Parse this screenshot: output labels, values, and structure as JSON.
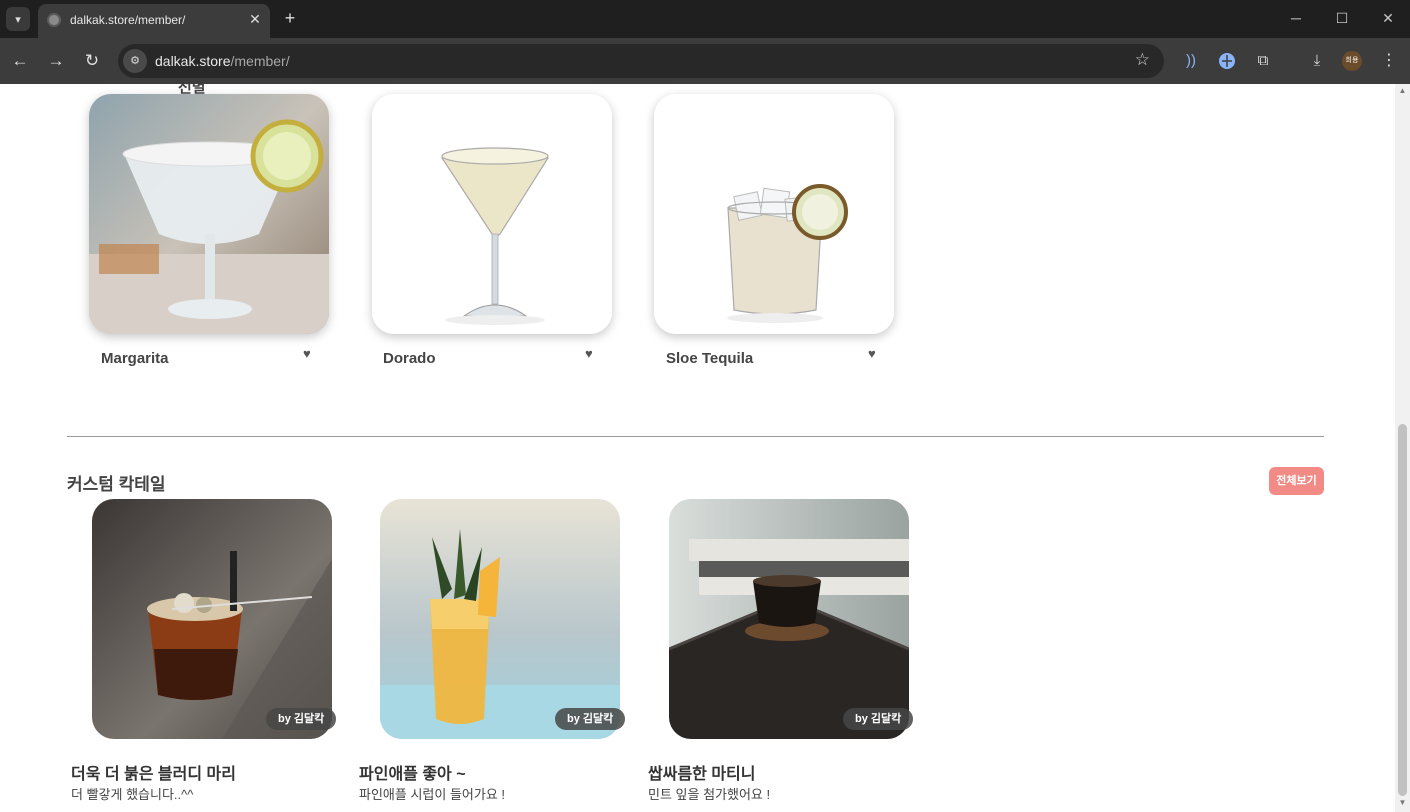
{
  "browser": {
    "tab_title": "dalkak.store/member/",
    "url_host": "dalkak.store",
    "url_path": "/member/",
    "profile_label": "희용",
    "icons": [
      "tab-search-icon",
      "globe-icon",
      "close-icon",
      "plus-icon",
      "minimize-icon",
      "maximize-icon",
      "window-close-icon",
      "back-icon",
      "forward-icon",
      "reload-icon",
      "site-settings-icon",
      "star-icon",
      "cast-icon",
      "extension-globe-icon",
      "extensions-puzzle-icon",
      "download-icon",
      "kebab-menu-icon"
    ]
  },
  "favorites": {
    "section_heading_partial": "선별",
    "items": [
      {
        "name": "Margarita",
        "icon": "heart-icon"
      },
      {
        "name": "Dorado",
        "icon": "heart-icon"
      },
      {
        "name": "Sloe Tequila",
        "icon": "heart-icon"
      }
    ]
  },
  "custom": {
    "title": "커스텀 칵테일",
    "view_all": "전체보기",
    "items": [
      {
        "author": "by 김달칵",
        "title": "더욱 더 붉은 블러디 마리",
        "desc": "더 빨갛게 했습니다..^^"
      },
      {
        "author": "by 김달칵",
        "title": "파인애플 좋아 ~",
        "desc": "파인애플 시럽이 들어가요 !"
      },
      {
        "author": "by 김달칵",
        "title": "쌉싸름한 마티니",
        "desc": "민트 잎을 첨가했어요 !"
      }
    ]
  },
  "colors": {
    "accent_button": "#f28b86",
    "chrome_dark": "#1f1f1f",
    "toolbar": "#3c3c3c"
  }
}
